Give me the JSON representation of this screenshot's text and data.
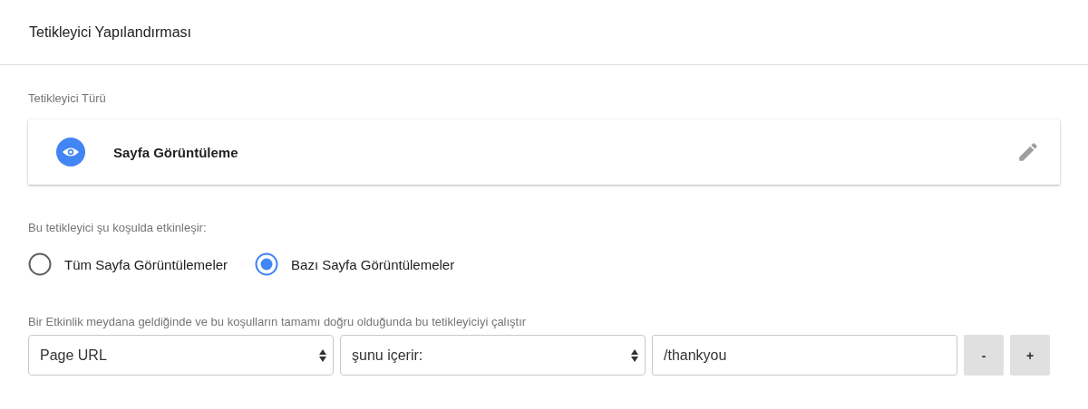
{
  "header": {
    "title": "Tetikleyici Yapılandırması"
  },
  "trigger_type": {
    "label": "Tetikleyici Türü",
    "name": "Sayfa Görüntüleme"
  },
  "fires_on": {
    "label": "Bu tetikleyici şu koşulda etkinleşir:",
    "options": [
      {
        "label": "Tüm Sayfa Görüntülemeler",
        "selected": false
      },
      {
        "label": "Bazı Sayfa Görüntülemeler",
        "selected": true
      }
    ]
  },
  "conditions": {
    "label": "Bir Etkinlik meydana geldiğinde ve bu koşulların tamamı doğru olduğunda bu tetikleyiciyi çalıştır",
    "rows": [
      {
        "variable": "Page URL",
        "operator": "şunu içerir:",
        "value": "/thankyou",
        "buttons": [
          "-",
          "+"
        ]
      }
    ]
  }
}
